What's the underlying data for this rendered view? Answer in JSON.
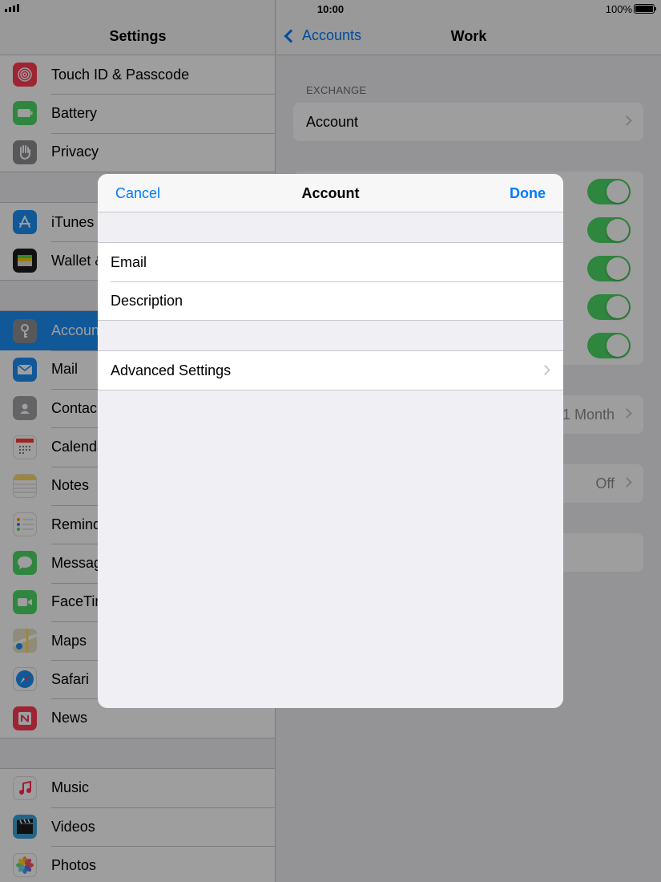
{
  "status_bar": {
    "time": "10:00",
    "battery": "100%"
  },
  "sidebar": {
    "title": "Settings",
    "groups": [
      [
        {
          "label": "Touch ID & Passcode",
          "icon": "fingerprint-icon",
          "color": "#ff3b55"
        },
        {
          "label": "Battery",
          "icon": "battery-icon",
          "color": "#4cd964"
        },
        {
          "label": "Privacy",
          "icon": "hand-icon",
          "color": "#8e8e93"
        }
      ],
      [
        {
          "label": "iTunes",
          "icon": "app-store-icon",
          "color": "#1a8ef6"
        },
        {
          "label": "Wallet &",
          "icon": "wallet-icon",
          "color": "#1c1c1e"
        }
      ],
      [
        {
          "label": "Accoun",
          "icon": "key-icon",
          "color": "#8e8e93"
        },
        {
          "label": "Mail",
          "icon": "mail-icon",
          "color": "#1a8ef6"
        },
        {
          "label": "Contac",
          "icon": "contacts-icon",
          "color": "#a2a2a7"
        },
        {
          "label": "Calenda",
          "icon": "calendar-icon",
          "color": "#ffffff"
        },
        {
          "label": "Notes",
          "icon": "notes-icon",
          "color": "#ffd95c"
        },
        {
          "label": "Remind",
          "icon": "reminders-icon",
          "color": "#ffffff"
        },
        {
          "label": "Messag",
          "icon": "messages-icon",
          "color": "#4cd964"
        },
        {
          "label": "FaceTin",
          "icon": "facetime-icon",
          "color": "#4cd964"
        },
        {
          "label": "Maps",
          "icon": "maps-icon",
          "color": "#7fcf6c"
        },
        {
          "label": "Safari",
          "icon": "safari-icon",
          "color": "#1a8ef6"
        },
        {
          "label": "News",
          "icon": "news-icon",
          "color": "#ff3b55"
        }
      ],
      [
        {
          "label": "Music",
          "icon": "music-icon",
          "color": "#ffffff"
        },
        {
          "label": "Videos",
          "icon": "videos-icon",
          "color": "#3aa3d8"
        },
        {
          "label": "Photos",
          "icon": "photos-icon",
          "color": "#ffffff"
        }
      ]
    ]
  },
  "detail": {
    "back_label": "Accounts",
    "title": "Work",
    "section_label": "EXCHANGE",
    "account_label": "Account",
    "mail_days": "1 Month",
    "auto_reply": "Off"
  },
  "modal": {
    "title": "Account",
    "cancel": "Cancel",
    "done": "Done",
    "fields": [
      "Email",
      "Description"
    ],
    "advanced": "Advanced Settings"
  },
  "colors": {
    "accent": "#007aff",
    "toggle_on": "#4cd964",
    "selected": "#1a8ef6"
  }
}
